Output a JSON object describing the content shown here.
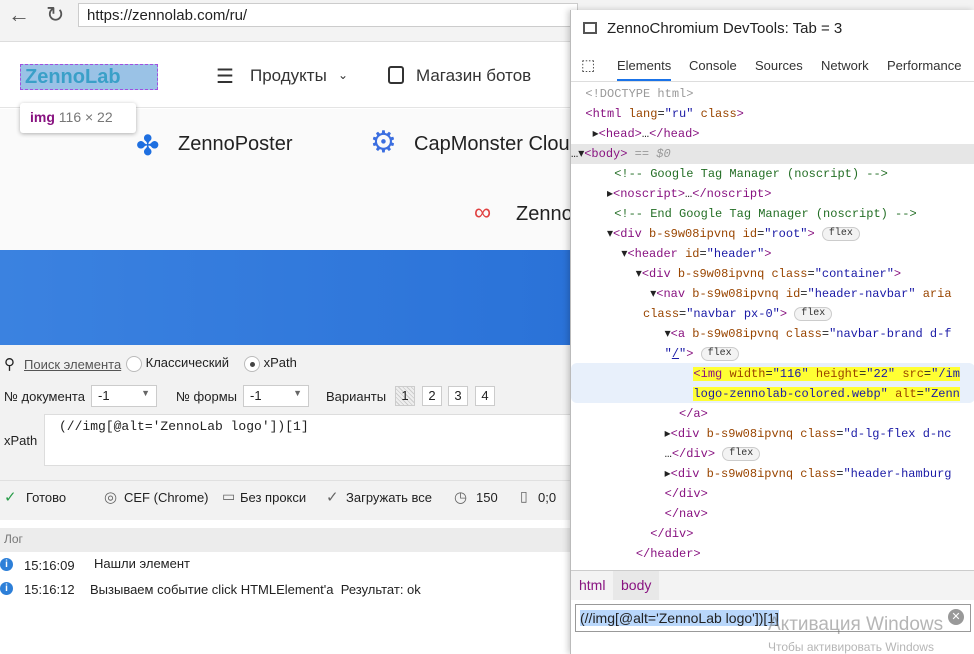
{
  "browser": {
    "url": "https://zennolab.com/ru/"
  },
  "site": {
    "logo": "ZennoLab",
    "nav_products": "Продукты",
    "nav_shop": "Магазин ботов",
    "tooltip_tag": "img",
    "tooltip_size": "116 × 22",
    "products": [
      "ZennoPoster",
      "CapMonster Cloud",
      "ZennoDroid"
    ]
  },
  "panel": {
    "search_link": "Поиск элемента",
    "mode_classic": "Классический",
    "mode_xpath": "xPath",
    "doc_label": "№ документа",
    "doc_value": "-1",
    "form_label": "№ формы",
    "form_value": "-1",
    "variants_label": "Варианты",
    "variants": [
      "1",
      "2",
      "3",
      "4"
    ],
    "xpath_label": "xPath",
    "xpath_value": "(//img[@alt='ZennoLab logo'])[1]"
  },
  "status": {
    "ready": "Готово",
    "engine": "CEF (Chrome)",
    "proxy": "Без прокси",
    "load": "Загружать все",
    "timeout": "150",
    "coords": "0;0"
  },
  "log": {
    "title": "Лог",
    "entries": [
      {
        "time": "15:16:09",
        "text": "Нашли элемент"
      },
      {
        "time": "15:16:12",
        "text": "Вызываем событие click HTMLElement'a  Результат: ok"
      }
    ]
  },
  "devtools": {
    "title": "ZennoChromium DevTools: Tab = 3",
    "tabs": [
      "Elements",
      "Console",
      "Sources",
      "Network",
      "Performance"
    ],
    "breadcrumbs": [
      "html",
      "body"
    ],
    "search_value": "(//img[@alt='ZennoLab logo'])[1]",
    "flex": "flex",
    "dollar": "== $0"
  },
  "watermark": {
    "line1": "Активация Windows",
    "line2": "Чтобы активировать Windows"
  }
}
